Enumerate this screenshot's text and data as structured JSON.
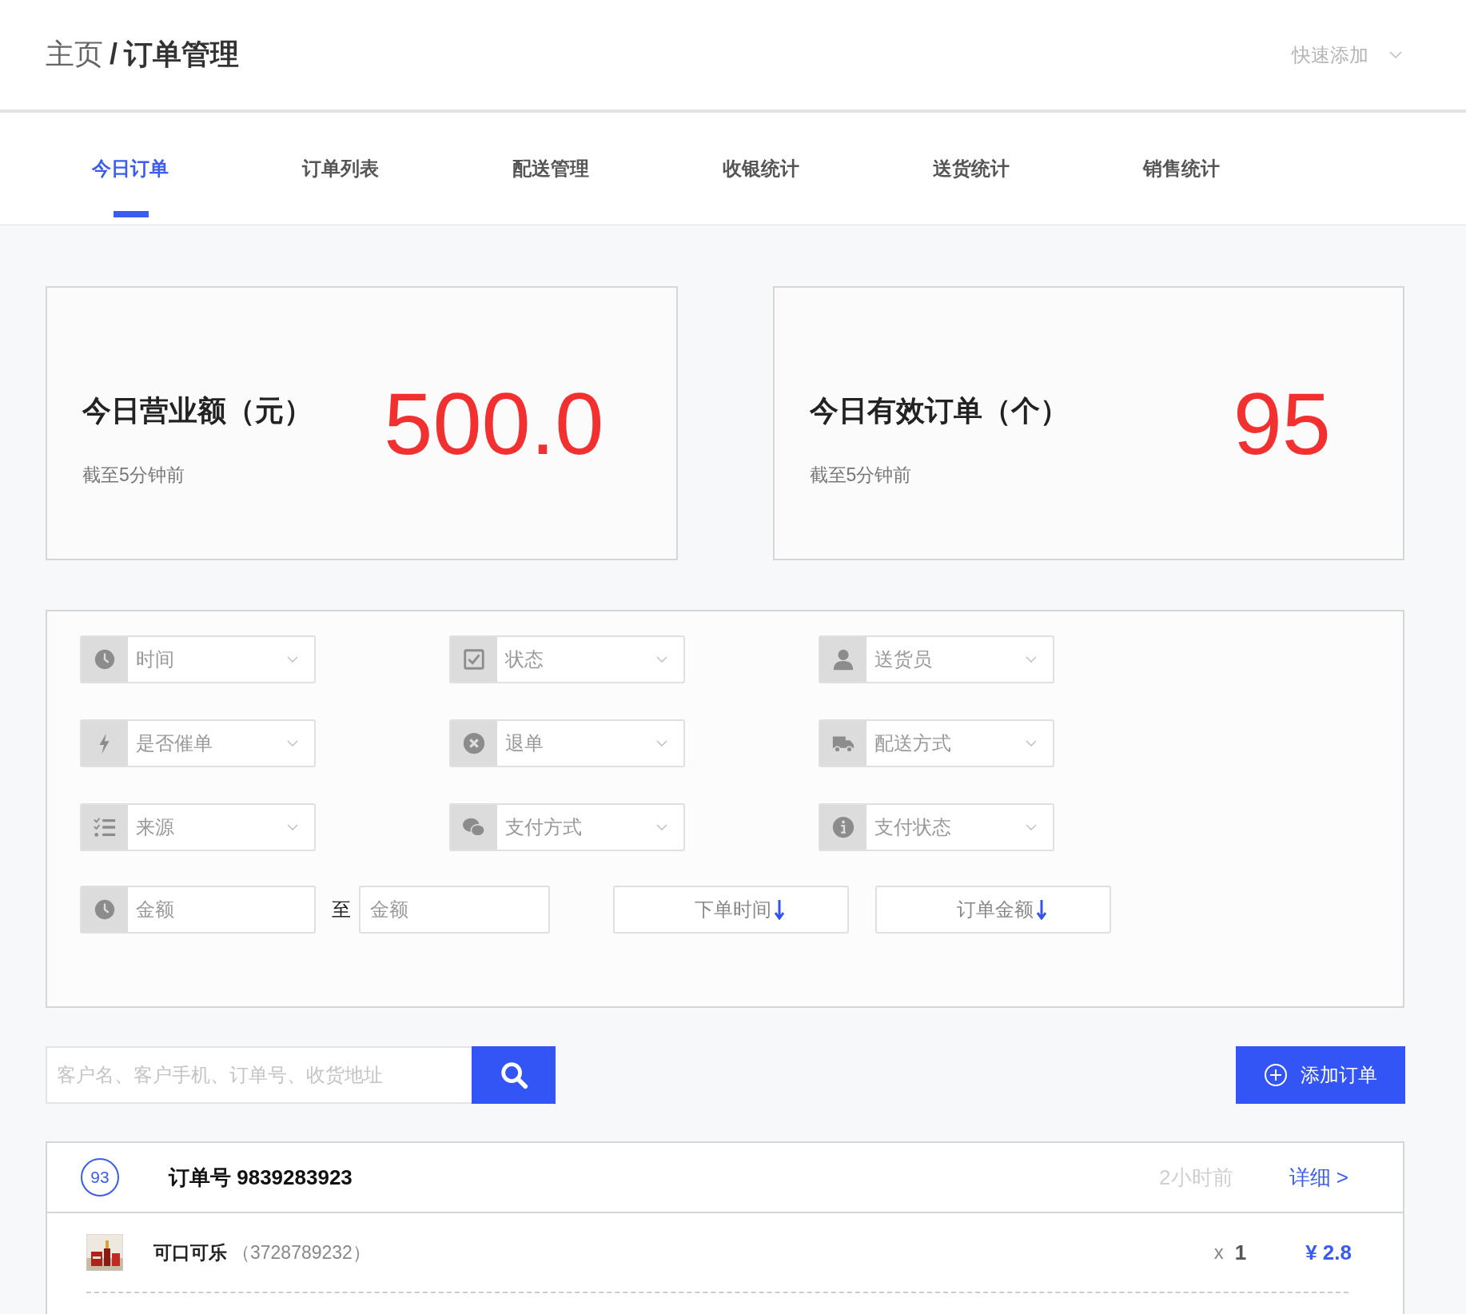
{
  "breadcrumb": {
    "parent": "主页",
    "separator": "/",
    "current": "订单管理"
  },
  "quick_add": {
    "label": "快速添加"
  },
  "tabs": [
    {
      "label": "今日订单",
      "selected": true
    },
    {
      "label": "订单列表",
      "selected": false
    },
    {
      "label": "配送管理",
      "selected": false
    },
    {
      "label": "收银统计",
      "selected": false
    },
    {
      "label": "送货统计",
      "selected": false
    },
    {
      "label": "销售统计",
      "selected": false
    }
  ],
  "stats": [
    {
      "title": "今日营业额（元）",
      "note": "截至5分钟前",
      "value": "500.0"
    },
    {
      "title": "今日有效订单（个）",
      "note": "截至5分钟前",
      "value": "95"
    }
  ],
  "filters": [
    {
      "placeholder": "时间"
    },
    {
      "placeholder": "状态"
    },
    {
      "placeholder": "送货员"
    },
    {
      "placeholder": "是否催单"
    },
    {
      "placeholder": "退单"
    },
    {
      "placeholder": "配送方式"
    },
    {
      "placeholder": "来源"
    },
    {
      "placeholder": "支付方式"
    },
    {
      "placeholder": "支付状态"
    }
  ],
  "amount_range": {
    "from_placeholder": "金额",
    "separator": "至",
    "to_placeholder": "金额"
  },
  "sort_buttons": [
    {
      "label": "下单时间"
    },
    {
      "label": "订单金额"
    }
  ],
  "search": {
    "placeholder": "客户名、客户手机、订单号、收货地址"
  },
  "add_button": {
    "label": "添加订单"
  },
  "order": {
    "badge": "93",
    "number": "订单号 9839283923",
    "time": "2小时前",
    "detail_link": "详细 >",
    "items": [
      {
        "name": "可口可乐",
        "code": "（3728789232）",
        "quantity_mark": "x",
        "quantity": "1",
        "price": "¥ 2.8"
      }
    ]
  }
}
